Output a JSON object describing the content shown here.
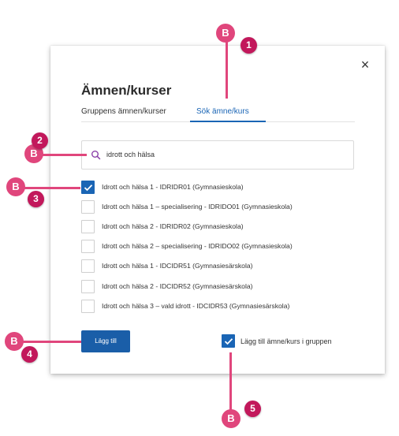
{
  "dialog": {
    "title": "Ämnen/kurser",
    "close_icon": "close-icon",
    "close_symbol": "×"
  },
  "tabs": [
    {
      "label": "Gruppens ämnen/kurser",
      "active": false
    },
    {
      "label": "Sök ämne/kurs",
      "active": true
    }
  ],
  "search": {
    "icon": "search-icon",
    "value": "idrott och hälsa"
  },
  "results": [
    {
      "label": "Idrott och hälsa 1 - IDRIDR01 (Gymnasieskola)",
      "checked": true
    },
    {
      "label": "Idrott och hälsa 1 – specialisering - IDRIDO01 (Gymnasieskola)",
      "checked": false
    },
    {
      "label": "Idrott och hälsa 2 - IDRIDR02 (Gymnasieskola)",
      "checked": false
    },
    {
      "label": "Idrott och hälsa 2 – specialisering - IDRIDO02 (Gymnasieskola)",
      "checked": false
    },
    {
      "label": "Idrott och hälsa 1 - IDCIDR51 (Gymnasiesärskola)",
      "checked": false
    },
    {
      "label": "Idrott och hälsa 2 - IDCIDR52 (Gymnasiesärskola)",
      "checked": false
    },
    {
      "label": "Idrott och hälsa 3 – vald idrott - IDCIDR53 (Gymnasiesärskola)",
      "checked": false
    }
  ],
  "footer": {
    "add_button": "Lägg till",
    "add_to_group_label": "Lägg till ämne/kurs i gruppen",
    "add_to_group_checked": true
  },
  "callouts": [
    {
      "letter": "B",
      "number": "1"
    },
    {
      "letter": "B",
      "number": "2"
    },
    {
      "letter": "B",
      "number": "3"
    },
    {
      "letter": "B",
      "number": "4"
    },
    {
      "letter": "B",
      "number": "5"
    }
  ],
  "colors": {
    "accent": "#1a65b5",
    "button": "#1a5ea8",
    "callout": "#e0467c",
    "callout_number": "#c2185b"
  }
}
